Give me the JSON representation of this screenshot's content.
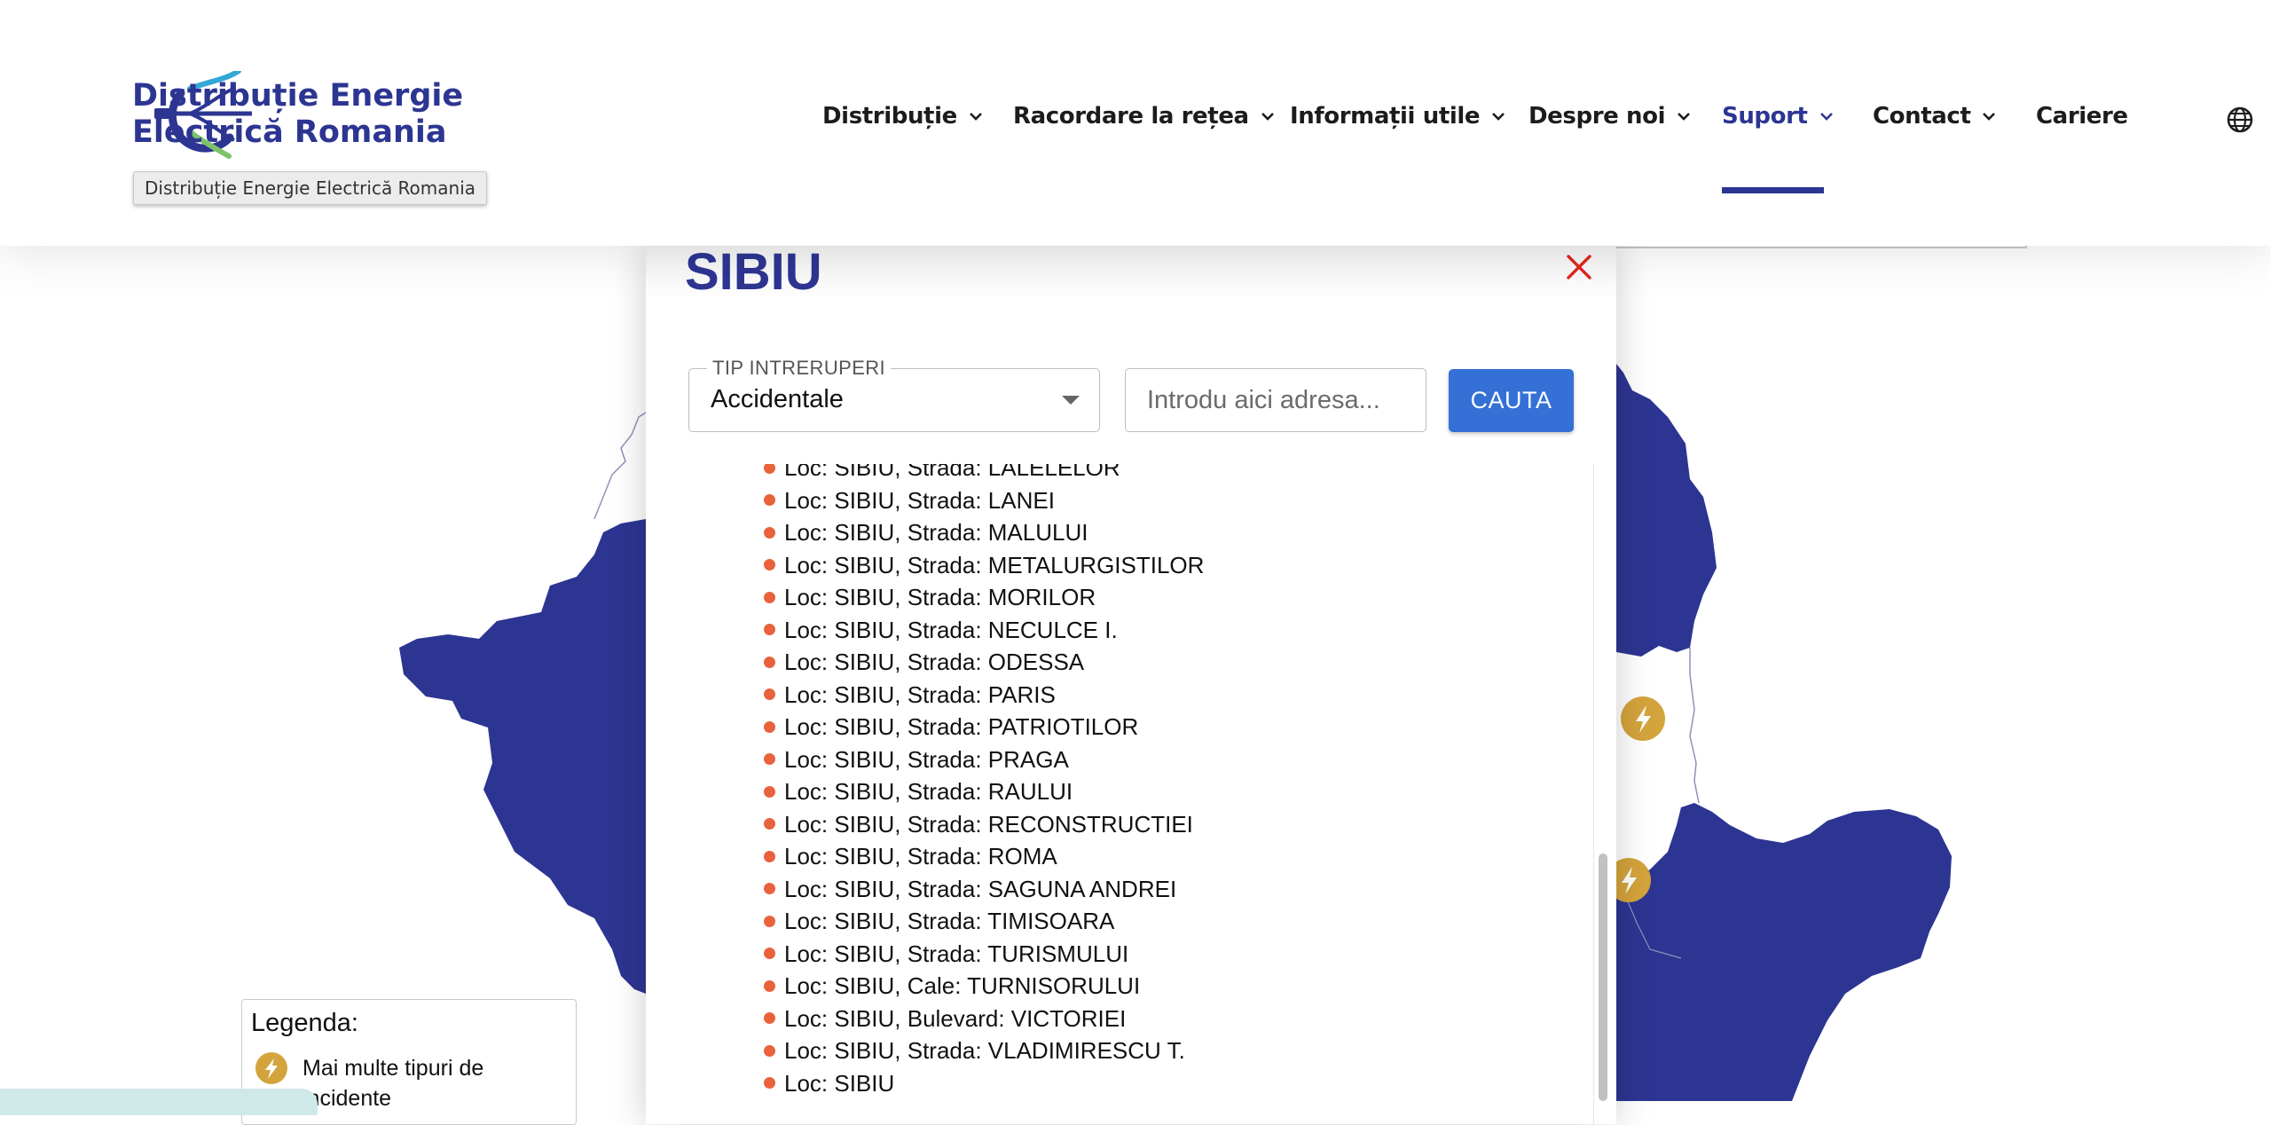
{
  "header": {
    "logo_line1": "Distribuție Energie",
    "logo_line2": "Electrică Romania",
    "logo_tooltip": "Distribuție Energie Electrică Romania",
    "nav": [
      {
        "label": "Distribuție",
        "has_dropdown": true,
        "active": false
      },
      {
        "label": "Racordare la rețea",
        "has_dropdown": true,
        "active": false
      },
      {
        "label": "Informații utile",
        "has_dropdown": true,
        "active": false
      },
      {
        "label": "Despre noi",
        "has_dropdown": true,
        "active": false
      },
      {
        "label": "Suport",
        "has_dropdown": true,
        "active": true
      },
      {
        "label": "Contact",
        "has_dropdown": true,
        "active": false
      },
      {
        "label": "Cariere",
        "has_dropdown": false,
        "active": false
      }
    ],
    "language_icon": "globe-icon"
  },
  "colors": {
    "brand_blue": "#2d3592",
    "button_blue": "#3470d6",
    "incident_orange": "#e8623c",
    "bolt_gold": "#d4a43c",
    "close_red": "#e0261c"
  },
  "modal": {
    "title": "SIBIU",
    "close_icon": "close-icon",
    "filter_label": "TIP INTRERUPERI",
    "filter_value": "Accidentale",
    "address_placeholder": "Introdu aici adresa...",
    "search_label": "CAUTA",
    "streets": [
      "Loc: SIBIU, Strada: LALELELOR",
      "Loc: SIBIU, Strada: LANEI",
      "Loc: SIBIU, Strada: MALULUI",
      "Loc: SIBIU, Strada: METALURGISTILOR",
      "Loc: SIBIU, Strada: MORILOR",
      "Loc: SIBIU, Strada: NECULCE I.",
      "Loc: SIBIU, Strada: ODESSA",
      "Loc: SIBIU, Strada: PARIS",
      "Loc: SIBIU, Strada: PATRIOTILOR",
      "Loc: SIBIU, Strada: PRAGA",
      "Loc: SIBIU, Strada: RAULUI",
      "Loc: SIBIU, Strada: RECONSTRUCTIEI",
      "Loc: SIBIU, Strada: ROMA",
      "Loc: SIBIU, Strada: SAGUNA ANDREI",
      "Loc: SIBIU, Strada: TIMISOARA",
      "Loc: SIBIU, Strada: TURISMULUI",
      "Loc: SIBIU, Cale: TURNISORULUI",
      "Loc: SIBIU, Bulevard: VICTORIEI",
      "Loc: SIBIU, Strada: VLADIMIRESCU T.",
      "Loc: SIBIU"
    ]
  },
  "legend": {
    "title": "Legenda:",
    "item_icon": "bolt-icon",
    "item_text": "Mai multe tipuri de incidente"
  }
}
